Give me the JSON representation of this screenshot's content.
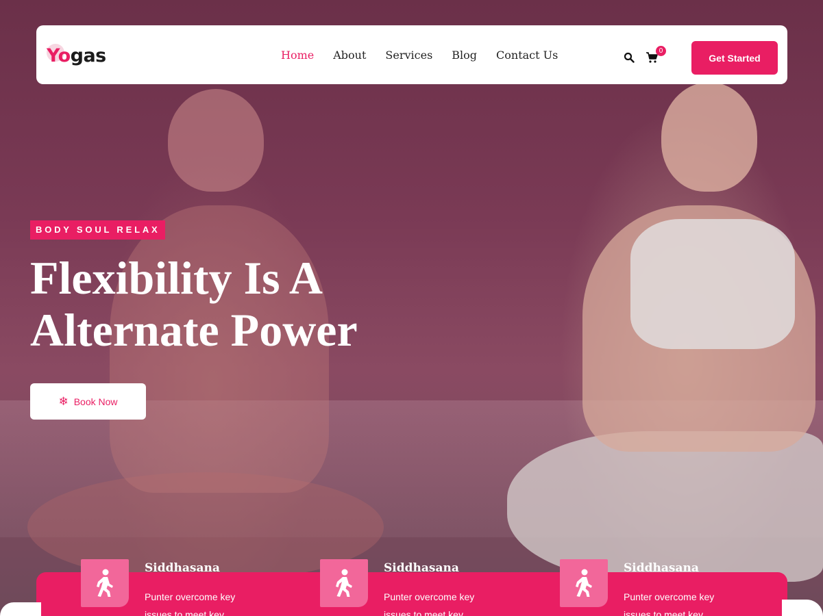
{
  "header": {
    "logo_text_first": "Yo",
    "logo_text_rest": "gas",
    "nav": [
      {
        "label": "Home",
        "active": true
      },
      {
        "label": "About",
        "active": false
      },
      {
        "label": "Services",
        "active": false
      },
      {
        "label": "Blog",
        "active": false
      },
      {
        "label": "Contact Us",
        "active": false
      }
    ],
    "search_icon": "search-icon",
    "cart_icon": "cart-icon",
    "cart_count": "0",
    "cta_label": "Get Started"
  },
  "hero": {
    "tag": "BODY SOUL RELAX",
    "title_line1": "Flexibility Is A",
    "title_line2": "Alternate Power",
    "book_icon": "snowflake-icon",
    "book_label": "Book Now"
  },
  "features": [
    {
      "icon": "walking-person-icon",
      "title": "Siddhasana",
      "desc": "Punter overcome key issues to meet key"
    },
    {
      "icon": "walking-person-icon",
      "title": "Siddhasana",
      "desc": "Punter overcome key issues to meet key"
    },
    {
      "icon": "walking-person-icon",
      "title": "Siddhasana",
      "desc": "Punter overcome key issues to meet key"
    }
  ],
  "colors": {
    "accent": "#e91e63",
    "accent_light": "#f2679a",
    "white": "#ffffff",
    "text_dark": "#222222"
  }
}
